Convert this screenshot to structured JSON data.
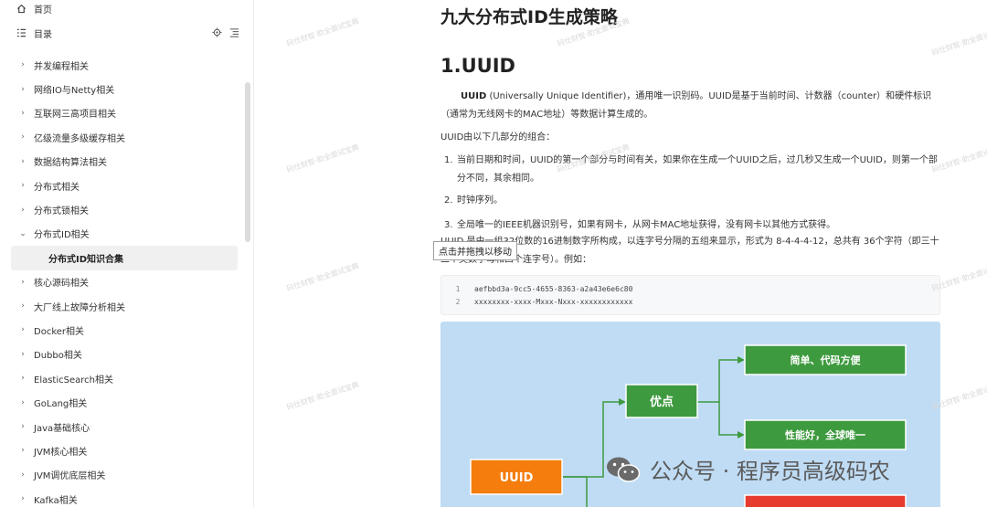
{
  "sidebar": {
    "home_label": "首页",
    "toc_label": "目录",
    "items": [
      {
        "label": "并发编程相关",
        "expanded": false
      },
      {
        "label": "网络IO与Netty相关",
        "expanded": false
      },
      {
        "label": "互联网三高项目相关",
        "expanded": false
      },
      {
        "label": "亿级流量多级缓存相关",
        "expanded": false
      },
      {
        "label": "数据结构算法相关",
        "expanded": false
      },
      {
        "label": "分布式相关",
        "expanded": false
      },
      {
        "label": "分布式锁相关",
        "expanded": false
      },
      {
        "label": "分布式ID相关",
        "expanded": true
      },
      {
        "label": "分布式ID知识合集",
        "sub": true,
        "active": true
      },
      {
        "label": "核心源码相关",
        "expanded": false
      },
      {
        "label": "大厂线上故障分析相关",
        "expanded": false
      },
      {
        "label": "Docker相关",
        "expanded": false
      },
      {
        "label": "Dubbo相关",
        "expanded": false
      },
      {
        "label": "ElasticSearch相关",
        "expanded": false
      },
      {
        "label": "GoLang相关",
        "expanded": false
      },
      {
        "label": "Java基础核心",
        "expanded": false
      },
      {
        "label": "JVM核心相关",
        "expanded": false
      },
      {
        "label": "JVM调优底层相关",
        "expanded": false
      },
      {
        "label": "Kafka相关",
        "expanded": false
      }
    ]
  },
  "article": {
    "title": "九大分布式ID生成策略",
    "h2": "1.UUID",
    "p1_bold": "UUID",
    "p1_rest": " (Universally Unique Identifier)，通用唯一识别码。UUID是基于当前时间、计数器（counter）和硬件标识（通常为无线网卡的MAC地址）等数据计算生成的。",
    "p2": "UUID由以下几部分的组合：",
    "list": [
      {
        "num": "1.",
        "text": "当前日期和时间，UUID的第一个部分与时间有关，如果你在生成一个UUID之后，过几秒又生成一个UUID，则第一个部分不同，其余相同。"
      },
      {
        "num": "2.",
        "text": "时钟序列。"
      },
      {
        "num": "3.",
        "text": "全局唯一的IEEE机器识别号，如果有网卡，从网卡MAC地址获得，没有网卡以其他方式获得。"
      }
    ],
    "p3": "UUID 是由一组32位数的16进制数字所构成，以连字号分隔的五组来显示，形式为 8-4-4-4-12，总共有 36个字符（即三十二个英数字母和四个连字号）。例如：",
    "tooltip": "点击并拖拽以移动",
    "code": [
      {
        "ln": "1",
        "text": "aefbbd3a-9cc5-4655-8363-a2a43e6e6c80"
      },
      {
        "ln": "2",
        "text": "xxxxxxxx-xxxx-Mxxx-Nxxx-xxxxxxxxxxxx"
      }
    ]
  },
  "diagram": {
    "root": "UUID",
    "mid": "优点",
    "leaf1": "简单、代码方便",
    "leaf2": "性能好，全球唯一",
    "colors": {
      "root": "#f47d0d",
      "node": "#3e9a3f",
      "bg": "#c0dcf5",
      "red": "#e63b2e"
    }
  },
  "watermark": "码仕财智·助全面试宝典",
  "wechat_label": "公众号 · 程序员高级码农"
}
